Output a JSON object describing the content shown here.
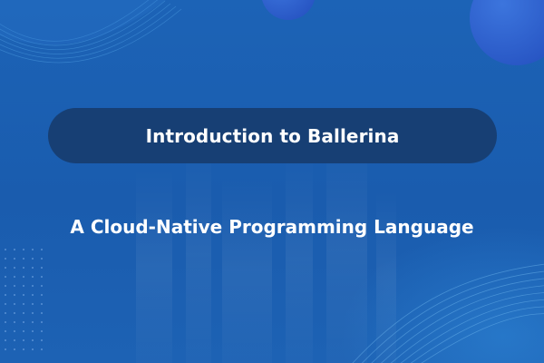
{
  "slide": {
    "title": "Introduction to Ballerina",
    "subtitle": "A Cloud-Native Programming Language"
  },
  "colors": {
    "background": "#1c63b6",
    "title_pill": "#173f74",
    "text": "#ffffff",
    "circle_accent": "#2f64d2"
  },
  "decor": {
    "top_circles": "circle-shape",
    "top_left_waves": "wave-lines",
    "bottom_right_waves": "wave-lines",
    "left_dots": "dot-grid",
    "center_bars": "faded-columns"
  }
}
